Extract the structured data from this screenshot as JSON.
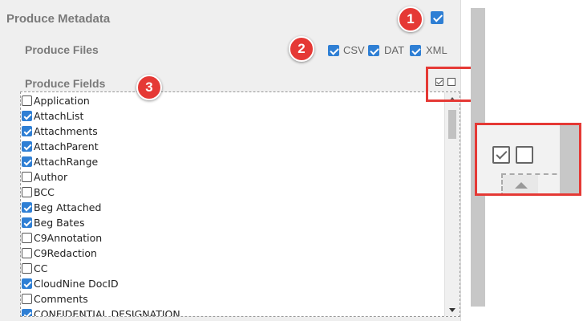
{
  "produce_metadata": {
    "label": "Produce Metadata",
    "checked": true
  },
  "produce_files": {
    "label": "Produce Files",
    "formats": [
      {
        "label": "CSV",
        "checked": true
      },
      {
        "label": "DAT",
        "checked": true
      },
      {
        "label": "XML",
        "checked": true
      }
    ]
  },
  "produce_fields": {
    "label": "Produce Fields",
    "fields": [
      {
        "label": "Application",
        "checked": false
      },
      {
        "label": "AttachList",
        "checked": true
      },
      {
        "label": "Attachments",
        "checked": true
      },
      {
        "label": "AttachParent",
        "checked": true
      },
      {
        "label": "AttachRange",
        "checked": true
      },
      {
        "label": "Author",
        "checked": false
      },
      {
        "label": "BCC",
        "checked": false
      },
      {
        "label": "Beg Attached",
        "checked": true
      },
      {
        "label": "Beg Bates",
        "checked": true
      },
      {
        "label": "C9Annotation",
        "checked": false
      },
      {
        "label": "C9Redaction",
        "checked": false
      },
      {
        "label": "CC",
        "checked": false
      },
      {
        "label": "CloudNine DocID",
        "checked": true
      },
      {
        "label": "Comments",
        "checked": false
      },
      {
        "label": "CONFIDENTIAL DESIGNATION",
        "checked": true
      }
    ]
  },
  "callouts": [
    "1",
    "2",
    "3"
  ],
  "colors": {
    "accent": "#2f7fd4",
    "callout": "#e53935",
    "panel": "#efefef"
  }
}
